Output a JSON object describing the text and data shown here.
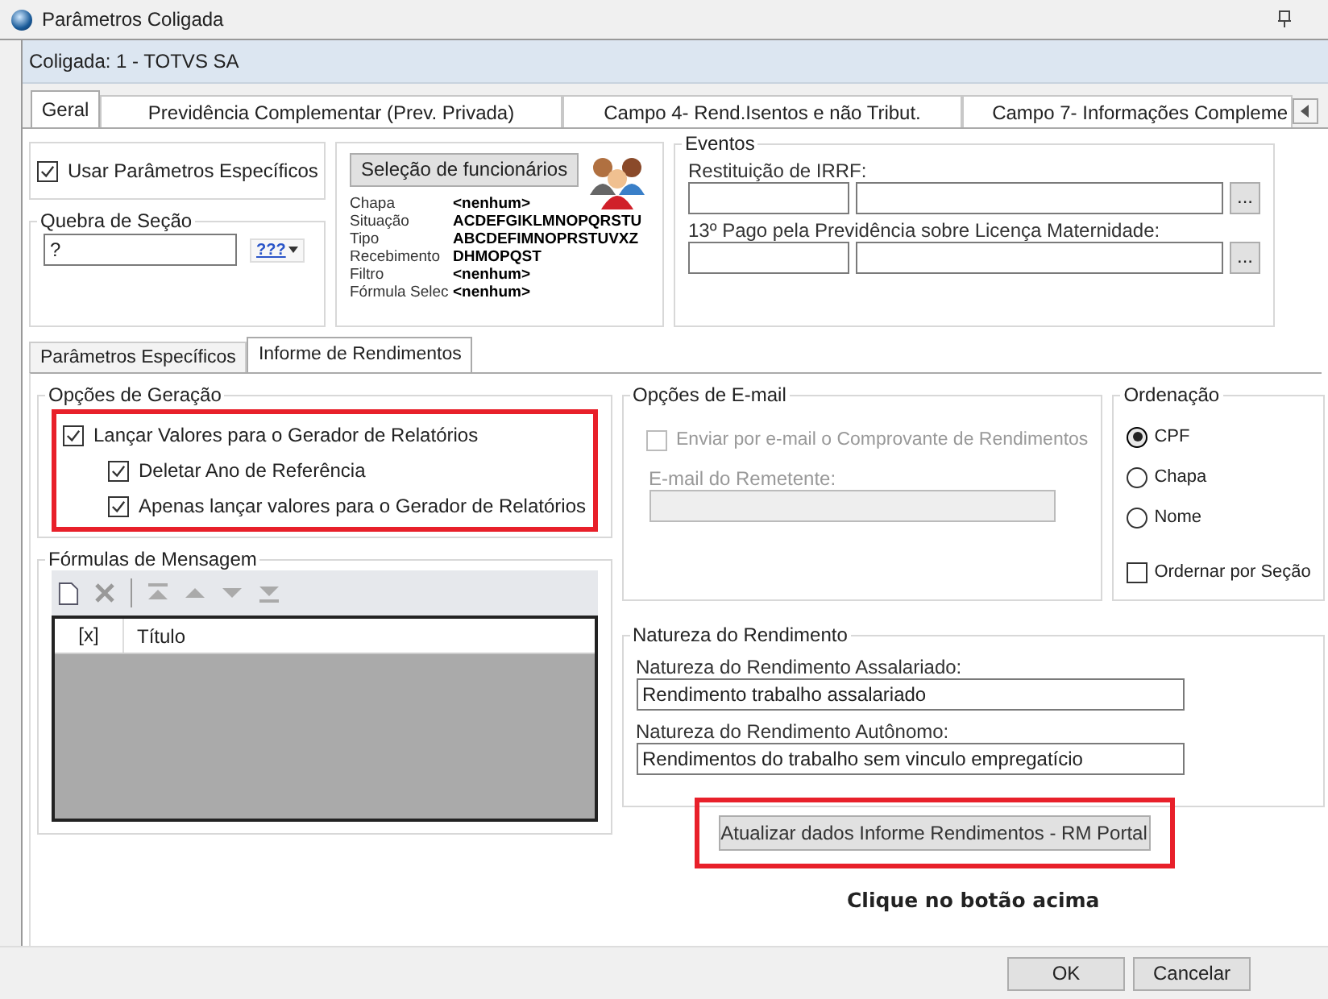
{
  "window": {
    "title": "Parâmetros Coligada"
  },
  "header": {
    "company": "Coligada: 1 - TOTVS SA"
  },
  "tabs": [
    {
      "label": "Geral",
      "selected": true
    },
    {
      "label": "Previdência Complementar (Prev. Privada)",
      "selected": false
    },
    {
      "label": "Campo 4- Rend.Isentos e não Tribut.",
      "selected": false
    },
    {
      "label": "Campo 7- Informações Compleme",
      "selected": false
    }
  ],
  "use_specific": {
    "label": "Usar Parâmetros Específicos",
    "checked": true
  },
  "section_break": {
    "title": "Quebra de Seção",
    "value": "?",
    "picker": "???"
  },
  "employee_selection": {
    "button": "Seleção de funcionários",
    "fields": [
      {
        "label": "Chapa",
        "value": "<nenhum>"
      },
      {
        "label": "Situação",
        "value": "ACDEFGIKLMNOPQRSTU"
      },
      {
        "label": "Tipo",
        "value": "ABCDEFIMNOPRSTUVXZ"
      },
      {
        "label": "Recebimento",
        "value": "DHMOPQST"
      },
      {
        "label": "Filtro",
        "value": "<nenhum>"
      },
      {
        "label": "Fórmula Selec",
        "value": "<nenhum>"
      }
    ]
  },
  "events": {
    "title": "Eventos",
    "fields": [
      {
        "label": "Restituição de IRRF:",
        "button": "..."
      },
      {
        "label": "13º Pago pela Previdência sobre Licença Maternidade:",
        "button": "..."
      }
    ]
  },
  "subtabs": [
    {
      "label": "Parâmetros Específicos",
      "selected": false
    },
    {
      "label": "Informe de Rendimentos",
      "selected": true
    }
  ],
  "generation_options": {
    "title": "Opções de Geração",
    "highlighted": true,
    "options": [
      {
        "label": "Lançar Valores para o Gerador de Relatórios",
        "checked": true,
        "children": [
          {
            "label": "Deletar Ano de Referência",
            "checked": true
          },
          {
            "label": "Apenas lançar valores para o Gerador de Relatórios",
            "checked": true
          }
        ]
      }
    ]
  },
  "message_formulas": {
    "title": "Fórmulas de Mensagem",
    "columns": [
      "[x]",
      "Título"
    ]
  },
  "email_options": {
    "title": "Opções de E-mail",
    "send": {
      "label": "Enviar por e-mail o Comprovante de Rendimentos",
      "checked": false,
      "disabled": true
    },
    "sender": {
      "label": "E-mail do Remetente:",
      "disabled": true
    }
  },
  "ordering": {
    "title": "Ordenação",
    "options": [
      {
        "label": "CPF",
        "selected": true
      },
      {
        "label": "Chapa",
        "selected": false
      },
      {
        "label": "Nome",
        "selected": false
      }
    ],
    "by_section": {
      "label": "Ordernar por Seção",
      "checked": false
    }
  },
  "income_nature": {
    "title": "Natureza do Rendimento",
    "fields": [
      {
        "label": "Natureza do Rendimento Assalariado:",
        "value": "Rendimento trabalho assalariado"
      },
      {
        "label": "Natureza do Rendimento Autônomo:",
        "value": "Rendimentos do trabalho sem vinculo empregatício"
      }
    ]
  },
  "update_button": {
    "label": "Atualizar dados Informe Rendimentos - RM Portal",
    "highlighted": true
  },
  "note": "Clique no botão acima",
  "buttons": [
    {
      "label": "OK"
    },
    {
      "label": "Cancelar"
    }
  ]
}
